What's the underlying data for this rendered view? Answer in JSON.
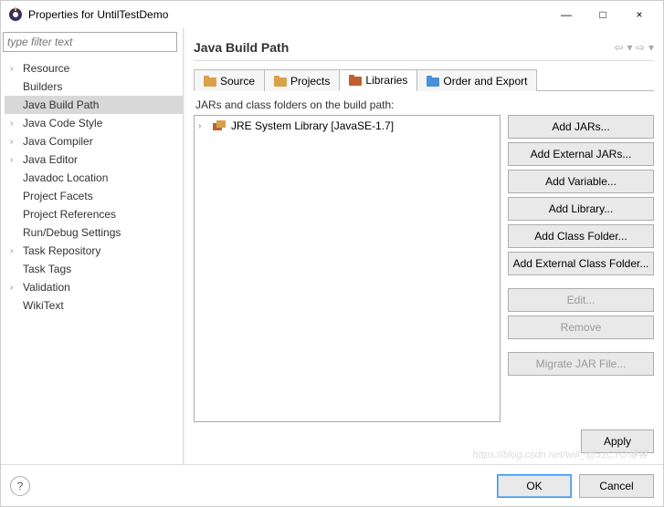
{
  "window": {
    "title": "Properties for UntilTestDemo",
    "buttons": {
      "min": "—",
      "max": "□",
      "close": "×"
    }
  },
  "filter": {
    "placeholder": "type filter text"
  },
  "tree": {
    "items": [
      {
        "label": "Resource",
        "expandable": true
      },
      {
        "label": "Builders",
        "expandable": false
      },
      {
        "label": "Java Build Path",
        "expandable": false,
        "selected": true
      },
      {
        "label": "Java Code Style",
        "expandable": true
      },
      {
        "label": "Java Compiler",
        "expandable": true
      },
      {
        "label": "Java Editor",
        "expandable": true
      },
      {
        "label": "Javadoc Location",
        "expandable": false
      },
      {
        "label": "Project Facets",
        "expandable": false
      },
      {
        "label": "Project References",
        "expandable": false
      },
      {
        "label": "Run/Debug Settings",
        "expandable": false
      },
      {
        "label": "Task Repository",
        "expandable": true
      },
      {
        "label": "Task Tags",
        "expandable": false
      },
      {
        "label": "Validation",
        "expandable": true
      },
      {
        "label": "WikiText",
        "expandable": false
      }
    ]
  },
  "page": {
    "heading": "Java Build Path",
    "tabs": [
      {
        "label": "Source"
      },
      {
        "label": "Projects"
      },
      {
        "label": "Libraries",
        "active": true
      },
      {
        "label": "Order and Export"
      }
    ],
    "list_desc": "JARs and class folders on the build path:",
    "entries": [
      {
        "label": "JRE System Library [JavaSE-1.7]"
      }
    ],
    "buttons": {
      "add_jars": "Add JARs...",
      "add_ext_jars": "Add External JARs...",
      "add_variable": "Add Variable...",
      "add_library": "Add Library...",
      "add_class_folder": "Add Class Folder...",
      "add_ext_class_folder": "Add External Class Folder...",
      "edit": "Edit...",
      "remove": "Remove",
      "migrate": "Migrate JAR File..."
    },
    "apply": "Apply"
  },
  "footer": {
    "ok": "OK",
    "cancel": "Cancel"
  },
  "watermark": "https://blog.csdn.net/will_@51CTO博客"
}
